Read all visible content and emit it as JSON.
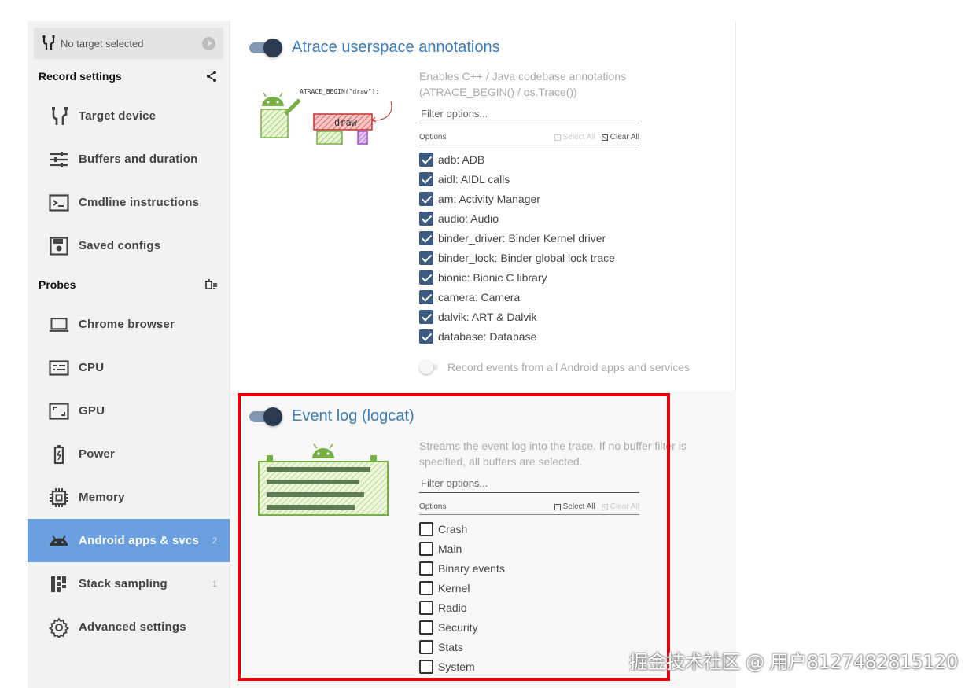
{
  "target": {
    "label": "No target selected"
  },
  "record_settings": {
    "header": "Record settings",
    "items": [
      {
        "label": "Target device",
        "icon": "usb-cable-icon"
      },
      {
        "label": "Buffers and duration",
        "icon": "sliders-icon"
      },
      {
        "label": "Cmdline instructions",
        "icon": "terminal-icon"
      },
      {
        "label": "Saved configs",
        "icon": "save-icon"
      }
    ]
  },
  "probes": {
    "header": "Probes",
    "items": [
      {
        "label": "Chrome browser",
        "icon": "laptop-icon",
        "count": ""
      },
      {
        "label": "CPU",
        "icon": "cpu-meter-icon",
        "count": ""
      },
      {
        "label": "GPU",
        "icon": "gpu-frame-icon",
        "count": ""
      },
      {
        "label": "Power",
        "icon": "battery-icon",
        "count": ""
      },
      {
        "label": "Memory",
        "icon": "memory-chip-icon",
        "count": ""
      },
      {
        "label": "Android apps & svcs",
        "icon": "android-icon",
        "count": "2",
        "active": true
      },
      {
        "label": "Stack sampling",
        "icon": "stack-icon",
        "count": "1"
      },
      {
        "label": "Advanced settings",
        "icon": "gear-icon",
        "count": ""
      }
    ]
  },
  "atrace": {
    "title": "Atrace userspace annotations",
    "description": "Enables C++ / Java codebase annotations (ATRACE_BEGIN() / os.Trace())",
    "image_caption": "ATRACE_BEGIN(\"draw\");",
    "image_block": "draw",
    "filter_placeholder": "Filter options...",
    "options_label": "Options",
    "select_all": "Select All",
    "clear_all": "Clear All",
    "options": [
      {
        "label": "adb: ADB",
        "checked": true
      },
      {
        "label": "aidl: AIDL calls",
        "checked": true
      },
      {
        "label": "am: Activity Manager",
        "checked": true
      },
      {
        "label": "audio: Audio",
        "checked": true
      },
      {
        "label": "binder_driver: Binder Kernel driver",
        "checked": true
      },
      {
        "label": "binder_lock: Binder global lock trace",
        "checked": true
      },
      {
        "label": "bionic: Bionic C library",
        "checked": true
      },
      {
        "label": "camera: Camera",
        "checked": true
      },
      {
        "label": "dalvik: ART & Dalvik",
        "checked": true
      },
      {
        "label": "database: Database",
        "checked": true
      }
    ],
    "record_all_label": "Record events from all Android apps and services"
  },
  "eventlog": {
    "title": "Event log (logcat)",
    "description": "Streams the event log into the trace. If no buffer filter is specified, all buffers are selected.",
    "filter_placeholder": "Filter options...",
    "options_label": "Options",
    "select_all": "Select All",
    "clear_all": "Clear All",
    "options": [
      {
        "label": "Crash",
        "checked": false
      },
      {
        "label": "Main",
        "checked": false
      },
      {
        "label": "Binary events",
        "checked": false
      },
      {
        "label": "Kernel",
        "checked": false
      },
      {
        "label": "Radio",
        "checked": false
      },
      {
        "label": "Security",
        "checked": false
      },
      {
        "label": "Stats",
        "checked": false
      },
      {
        "label": "System",
        "checked": false
      }
    ]
  },
  "watermark": "掘金技术社区 @ 用户8127482815120"
}
